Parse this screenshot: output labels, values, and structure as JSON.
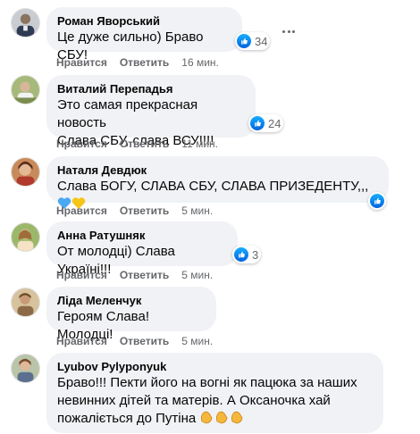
{
  "comments": [
    {
      "author": "Роман Яворський",
      "text": "Це дуже сильно) Браво СБУ!",
      "like_label": "Нравится",
      "reply_label": "Ответить",
      "time": "16 мин.",
      "reactions": "34"
    },
    {
      "author": "Виталий Перепадья",
      "text": "Это самая прекрасная новость\nСлава СБУ, слава ВСУ!!!!",
      "like_label": "Нравится",
      "reply_label": "Ответить",
      "time": "11 мин.",
      "reactions": "24"
    },
    {
      "author": "Наталя Девдюк",
      "text": "Слава БОГУ, СЛАВА СБУ, СЛАВА ПРИЗЕДЕНТУ,,,",
      "like_label": "Нравится",
      "reply_label": "Ответить",
      "time": "5 мин.",
      "reactions": ""
    },
    {
      "author": "Анна Ратушняк",
      "text": "От молодці) Слава Україні!!!",
      "like_label": "Нравится",
      "reply_label": "Ответить",
      "time": "5 мин.",
      "reactions": "3"
    },
    {
      "author": "Ліда Меленчук",
      "text": "Героям Слава! Молодці!",
      "like_label": "Нравится",
      "reply_label": "Ответить",
      "time": "5 мин.",
      "reactions": ""
    },
    {
      "author": "Lyubov Pylyponyuk",
      "text": "Браво!!! Пекти його на вогні як пацюка за наших\nневинних дітей та матерів. А Оксаночка хай\nпожаліється до Путіна",
      "like_label": "Нравится",
      "reply_label": "Ответить",
      "time": "5 мин.",
      "reactions": ""
    }
  ],
  "icons": {
    "like": "like-icon",
    "more": "more-options-icon",
    "hearts": "blue-yellow-hearts",
    "clap": "clapping-hands"
  },
  "colors": {
    "bubble": "#f0f2f5",
    "like_blue": "#1877f2",
    "meta_gray": "#65676b"
  }
}
